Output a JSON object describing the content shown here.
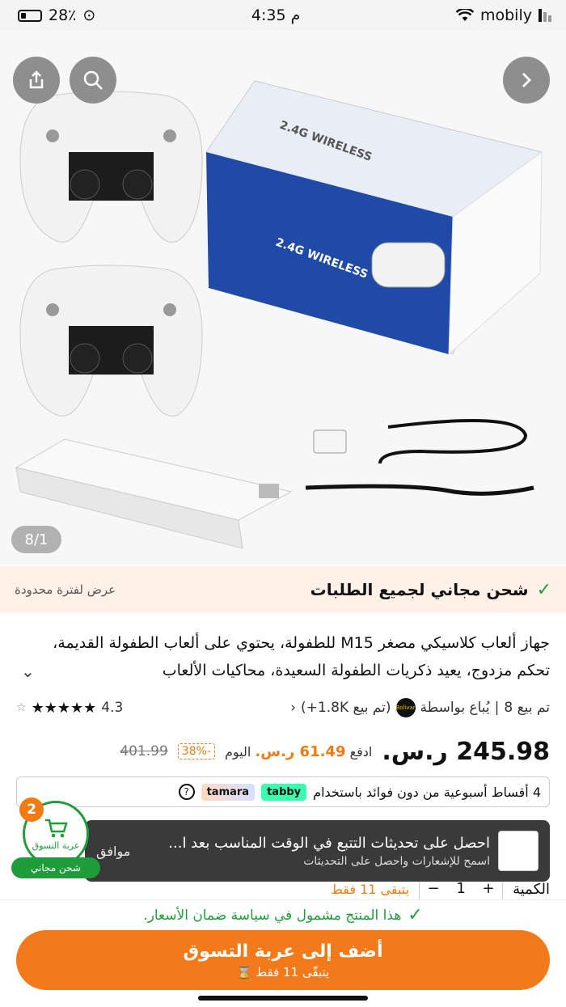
{
  "status_bar": {
    "battery": "28٪",
    "time": "4:35 م",
    "carrier": "mobily"
  },
  "hero": {
    "image_counter": "8/1",
    "box_text": "2.4G WIRELESS"
  },
  "promo": {
    "main": "شحن مجاني لجميع الطلبات",
    "side": "عرض لفترة محدودة"
  },
  "product": {
    "title": "جهاز ألعاب كلاسيكي مصغر M15 للطفولة، يحتوي على ألعاب الطفولة القديمة، تحكم مزدوج، يعيد ذكريات الطفولة السعيدة، محاكيات الألعاب",
    "sold_count": "تم بيع 8",
    "sold_by_label": "يُباع بواسطة",
    "seller_logo": "Bolivar",
    "seller_sold": "(تم بيع 1.8K+)",
    "rating": "4.3",
    "stars": 5
  },
  "price": {
    "current": "245.98 ر.س.",
    "pay_prefix": "ادفع",
    "pay_amount": "61.49 ر.س.",
    "pay_suffix": "اليوم",
    "discount": "-38%",
    "old": "401.99"
  },
  "installments": {
    "text": "4 أقساط أسبوعية من دون فوائد باستخدام",
    "provider1": "tabby",
    "provider2": "tamara",
    "info_icon": "?"
  },
  "toast": {
    "title": "احصل على تحديثات التتبع في الوقت المناسب بعد ا...",
    "subtitle": "اسمح للإشعارات واحصل على التحديثات",
    "action": "موافق"
  },
  "quantity": {
    "label": "الكمية",
    "value": "1",
    "minus": "−",
    "plus": "+",
    "stock": "يتبقى 11 فقط"
  },
  "guarantee": "هذا المنتج مشمول في سياسة ضمان الأسعار.",
  "add_to_cart": {
    "label": "أضف إلى عربة التسوق",
    "sub": "يتبقّى 11 فقط"
  },
  "floating_cart": {
    "count": "2",
    "label": "عربة التسوق",
    "shipping": "شحن مجاني"
  },
  "colors": {
    "accent": "#f27a1a",
    "success": "#1f9d3a",
    "promo_bg": "#fff1e8"
  }
}
